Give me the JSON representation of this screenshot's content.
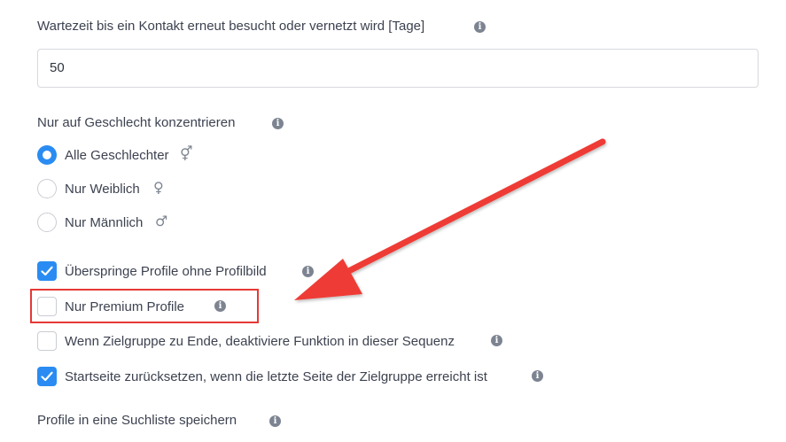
{
  "wait_setting": {
    "label": "Wartezeit bis ein Kontakt erneut besucht oder vernetzt wird [Tage]",
    "value": "50"
  },
  "gender": {
    "label": "Nur auf Geschlecht konzentrieren",
    "options": [
      {
        "label": "Alle Geschlechter",
        "icon": "⚥",
        "selected": true
      },
      {
        "label": "Nur Weiblich",
        "icon": "♀",
        "selected": false
      },
      {
        "label": "Nur Männlich",
        "icon": "♂",
        "selected": false
      }
    ]
  },
  "checkboxes": [
    {
      "label": "Überspringe Profile ohne Profilbild",
      "checked": true
    },
    {
      "label": "Nur Premium Profile",
      "checked": false
    },
    {
      "label": "Wenn Zielgruppe zu Ende, deaktiviere Funktion in dieser Sequenz",
      "checked": false
    },
    {
      "label": "Startseite zurücksetzen, wenn die letzte Seite der Zielgruppe erreicht ist",
      "checked": true
    }
  ],
  "search_list": {
    "label": "Profile in eine Suchliste speichern"
  },
  "info_glyph": "i",
  "colors": {
    "accent": "#2a8cf2",
    "annotation": "#e53935"
  }
}
